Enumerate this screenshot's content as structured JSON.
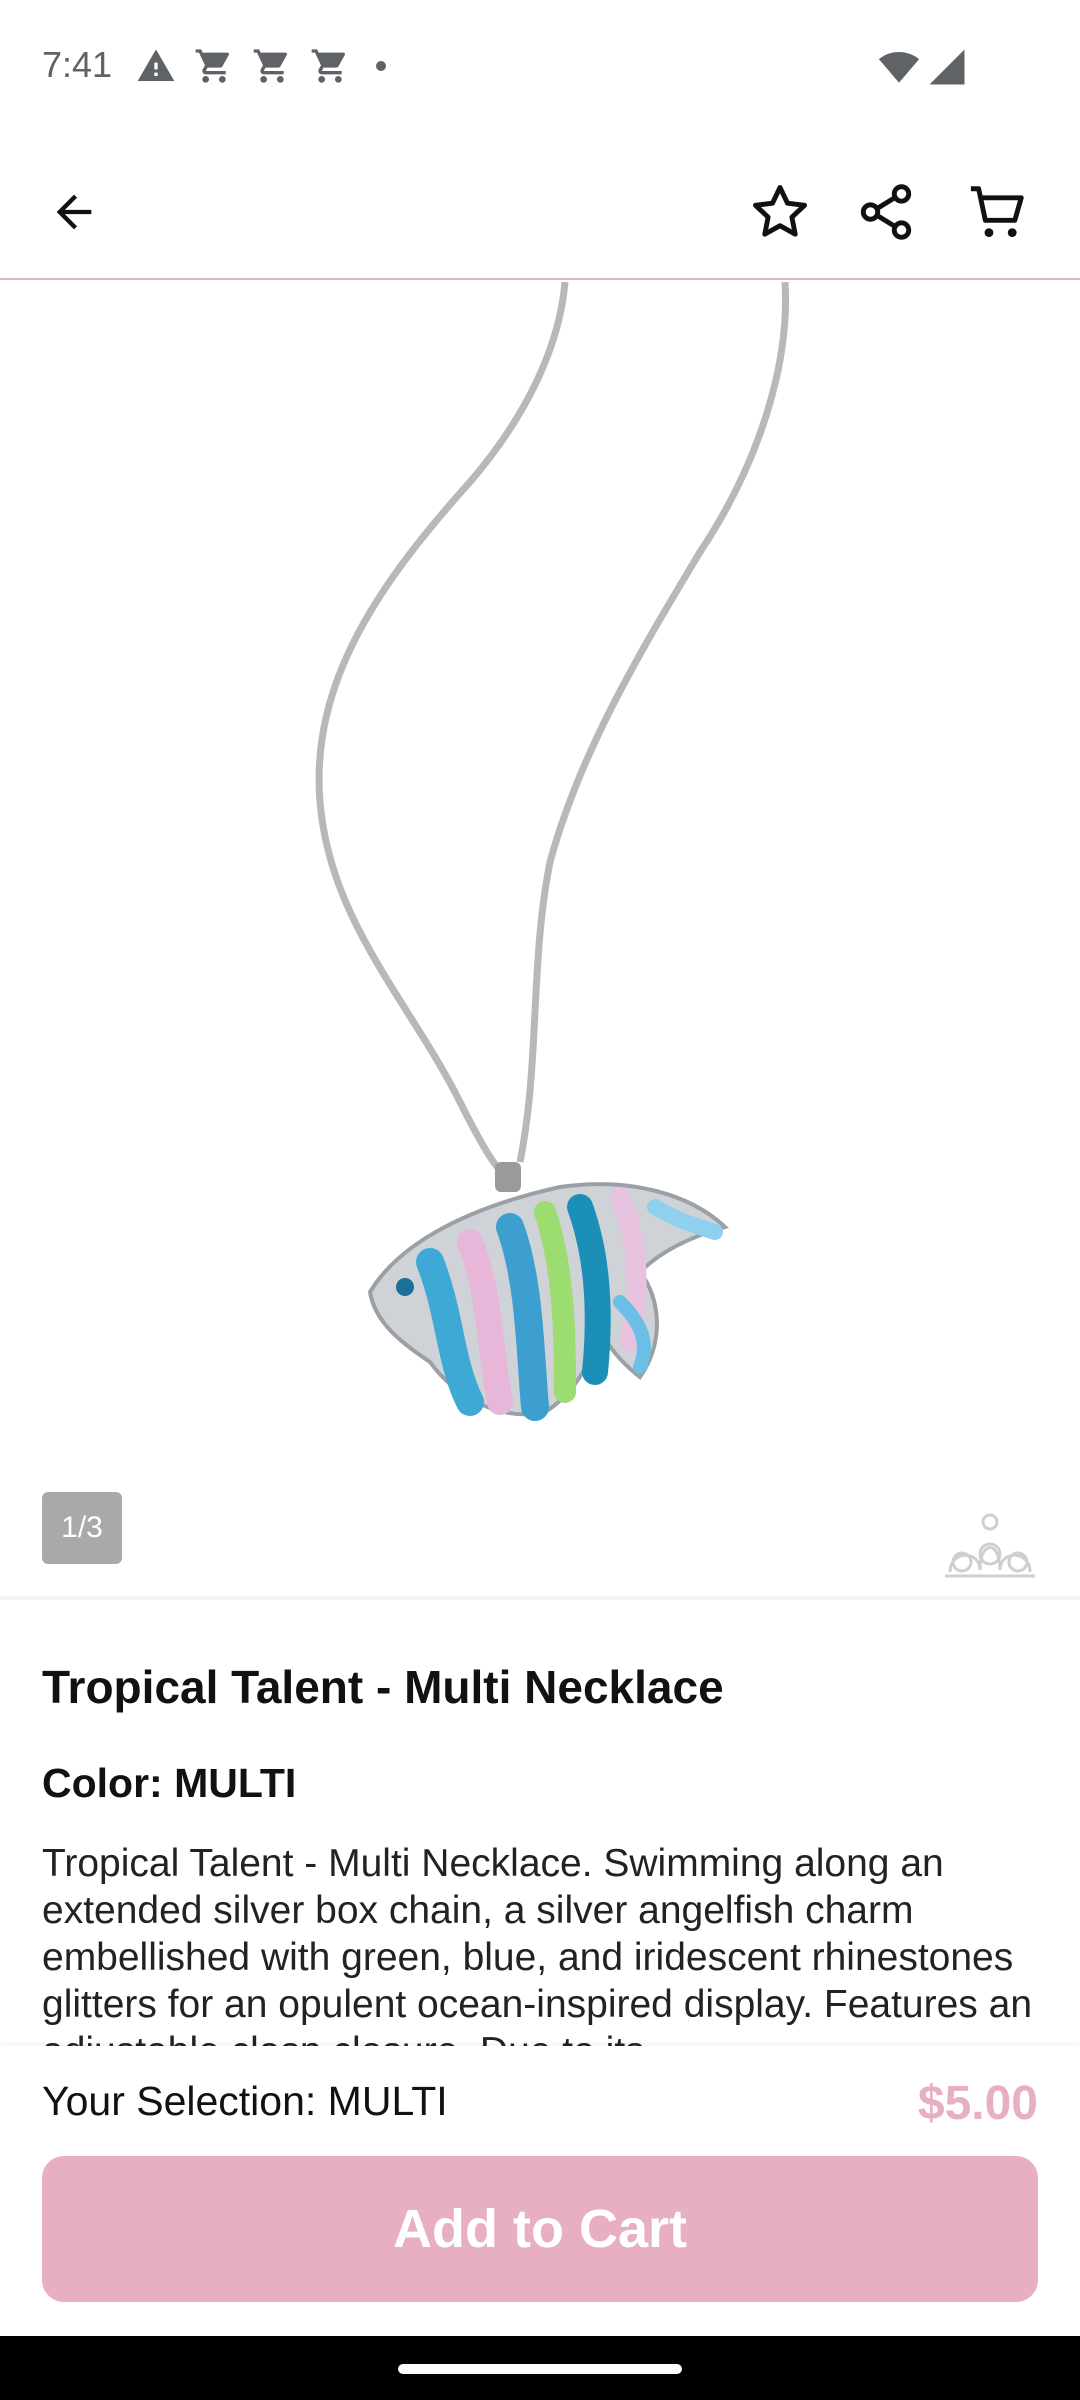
{
  "status_bar": {
    "time": "7:41"
  },
  "header": {
    "icons": [
      "arrow-left-icon",
      "star-icon",
      "share-icon",
      "cart-icon"
    ]
  },
  "gallery": {
    "page_indicator": "1/3"
  },
  "product": {
    "title": "Tropical Talent - Multi Necklace",
    "color_line": "Color: MULTI",
    "description": "Tropical Talent - Multi Necklace. Swimming along an extended silver box chain, a silver angelfish charm embellished with green, blue, and iridescent rhinestones glitters for an opulent ocean-inspired display. Features an adjustable clasp closure. Due to its"
  },
  "purchase": {
    "selection": "Your Selection: MULTI",
    "price": "$5.00",
    "add_to_cart_label": "Add to Cart"
  },
  "colors": {
    "accent": "#e8aec4",
    "status_gray": "#5f6368",
    "indicator_bg": "#a9a9a9"
  }
}
